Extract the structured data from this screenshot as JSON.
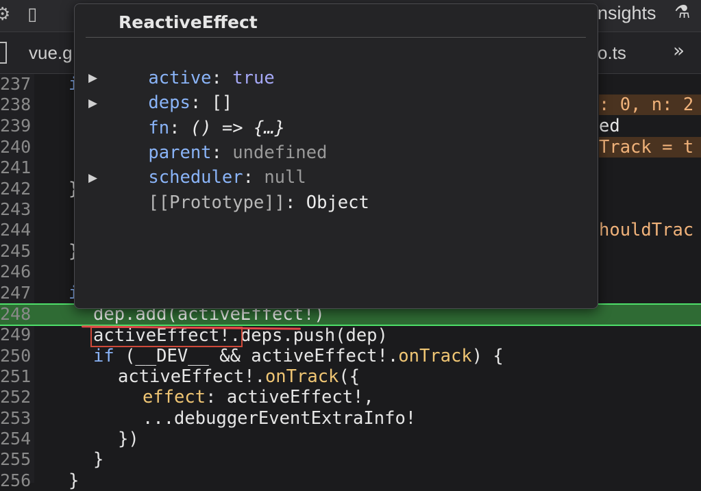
{
  "toolbar": {
    "insights_label": "nsights",
    "icons": [
      "gear-icon",
      "device-toggle-icon",
      "flask-icon"
    ]
  },
  "tabs": {
    "items": [
      {
        "label": "vue.g"
      },
      {
        "label": "o.ts"
      }
    ],
    "overflow_icon": "chevron-double-right-icon"
  },
  "colors": {
    "accent_keyword": "#8ab4f8",
    "execution_line": "#2f6b34",
    "execution_border": "#4fe06a",
    "marker_red": "#e04848"
  },
  "editor": {
    "line_numbers": [
      "237",
      "238",
      "239",
      "240",
      "241",
      "242",
      "243",
      "244",
      "245",
      "246",
      "247",
      "248",
      "249",
      "250",
      "251",
      "252",
      "253",
      "254",
      "255",
      "256"
    ],
    "lines": {
      "l237": "i",
      "l242": "}",
      "l245": "}",
      "l247": "i",
      "l248": "dep.add(activeEffect!)",
      "l249a": "activeEffect",
      "l249b": "!.deps.push(dep)",
      "l250_kw": "if",
      "l250_rest": " (__DEV__ && activeEffect!.",
      "l250_fn": "onTrack",
      "l250_end": ") {",
      "l251_a": "activeEffect!.",
      "l251_fn": "onTrack",
      "l251_b": "({",
      "l252_key": "effect",
      "l252_rest": ": activeEffect!,",
      "l253": "...debuggerEventExtraInfo!",
      "l254": "})",
      "l255": "}",
      "l256": "}"
    },
    "right_fragments": {
      "r238": ": 0, n: 2",
      "r239": "ed",
      "r240": "Track = t",
      "r244": "houldTrac"
    }
  },
  "popover": {
    "title": "ReactiveEffect",
    "rows": [
      {
        "key": "active",
        "value": "true",
        "expandable": false
      },
      {
        "key": "deps",
        "value": "[]",
        "expandable": true
      },
      {
        "key": "fn",
        "value": "() => {…}",
        "expandable": true
      },
      {
        "key": "parent",
        "value": "undefined",
        "expandable": false
      },
      {
        "key": "scheduler",
        "value": "null",
        "expandable": false
      },
      {
        "key": "[[Prototype]]",
        "value": "Object",
        "expandable": true
      }
    ]
  }
}
